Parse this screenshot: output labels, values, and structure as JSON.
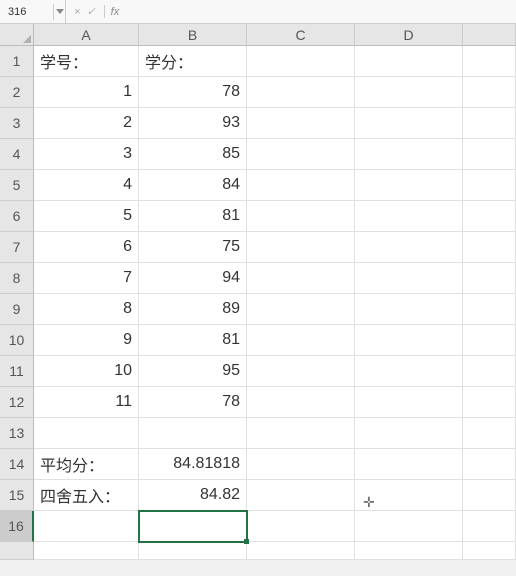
{
  "nameBox": "316",
  "fxLabel": "fx",
  "formulaBtns": {
    "cancel": "×",
    "check": "✓"
  },
  "columns": [
    "A",
    "B",
    "C",
    "D",
    ""
  ],
  "rowCount": 16,
  "cells": {
    "A1": {
      "v": "学号：",
      "t": "txt"
    },
    "B1": {
      "v": "学分：",
      "t": "txt"
    },
    "A2": {
      "v": "1",
      "t": "num"
    },
    "B2": {
      "v": "78",
      "t": "num"
    },
    "A3": {
      "v": "2",
      "t": "num"
    },
    "B3": {
      "v": "93",
      "t": "num"
    },
    "A4": {
      "v": "3",
      "t": "num"
    },
    "B4": {
      "v": "85",
      "t": "num"
    },
    "A5": {
      "v": "4",
      "t": "num"
    },
    "B5": {
      "v": "84",
      "t": "num"
    },
    "A6": {
      "v": "5",
      "t": "num"
    },
    "B6": {
      "v": "81",
      "t": "num"
    },
    "A7": {
      "v": "6",
      "t": "num"
    },
    "B7": {
      "v": "75",
      "t": "num"
    },
    "A8": {
      "v": "7",
      "t": "num"
    },
    "B8": {
      "v": "94",
      "t": "num"
    },
    "A9": {
      "v": "8",
      "t": "num"
    },
    "B9": {
      "v": "89",
      "t": "num"
    },
    "A10": {
      "v": "9",
      "t": "num"
    },
    "B10": {
      "v": "81",
      "t": "num"
    },
    "A11": {
      "v": "10",
      "t": "num"
    },
    "B11": {
      "v": "95",
      "t": "num"
    },
    "A12": {
      "v": "11",
      "t": "num"
    },
    "B12": {
      "v": "78",
      "t": "num"
    },
    "A14": {
      "v": "平均分：",
      "t": "txt"
    },
    "B14": {
      "v": "84.81818",
      "t": "num"
    },
    "A15": {
      "v": "四舍五入：",
      "t": "txt"
    },
    "B15": {
      "v": "84.82",
      "t": "num"
    }
  },
  "selectedCell": "B16",
  "selectedRow": 16,
  "chart_data": {
    "type": "table",
    "title": "学分表",
    "columns": [
      "学号",
      "学分"
    ],
    "rows": [
      [
        1,
        78
      ],
      [
        2,
        93
      ],
      [
        3,
        85
      ],
      [
        4,
        84
      ],
      [
        5,
        81
      ],
      [
        6,
        75
      ],
      [
        7,
        94
      ],
      [
        8,
        89
      ],
      [
        9,
        81
      ],
      [
        10,
        95
      ],
      [
        11,
        78
      ]
    ],
    "summary": {
      "平均分": 84.81818,
      "四舍五入": 84.82
    }
  }
}
